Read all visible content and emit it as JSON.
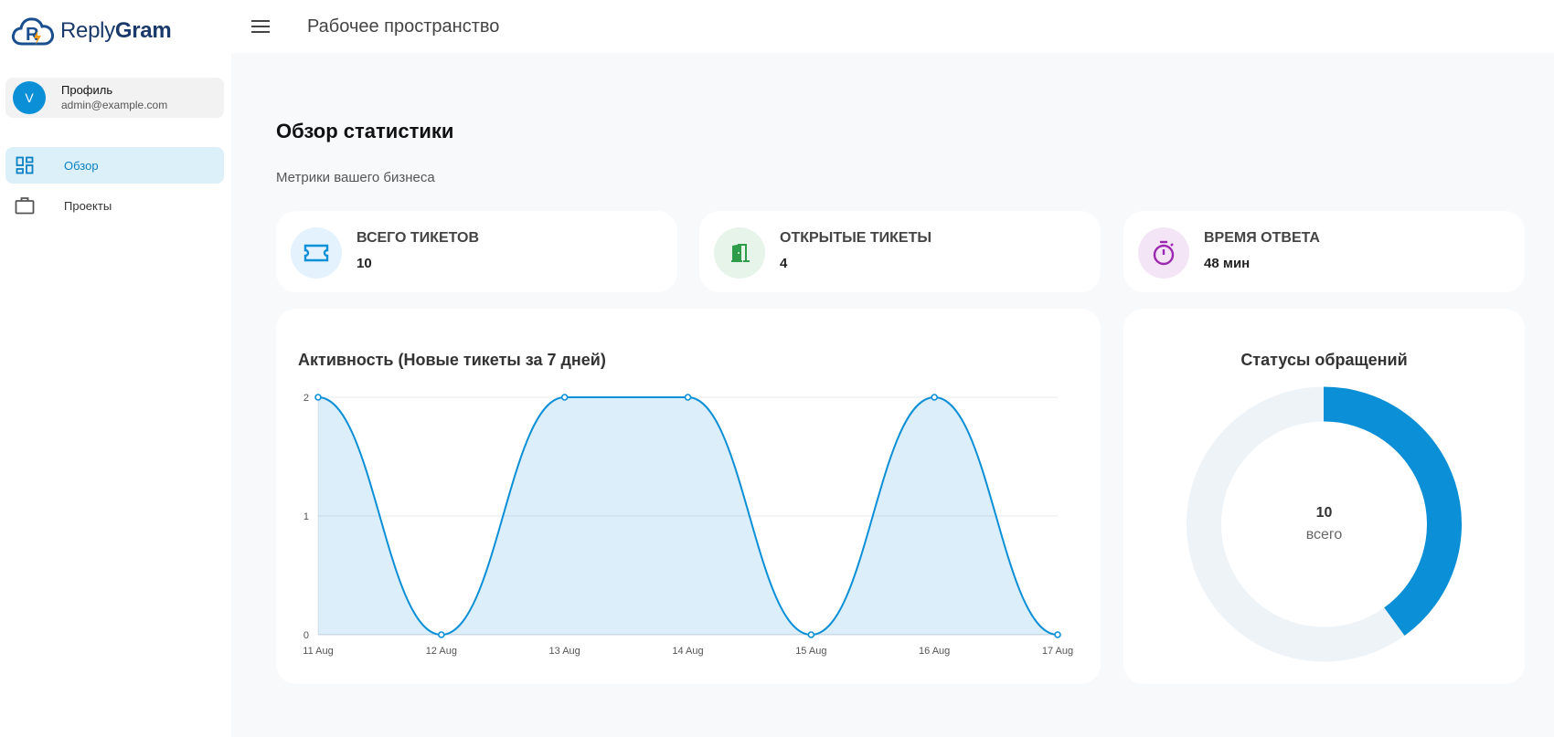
{
  "app": {
    "logo_light": "Reply",
    "logo_bold": "Gram",
    "topbar_title": "Рабочее пространство"
  },
  "profile": {
    "avatar_letter": "V",
    "name": "Профиль",
    "email": "admin@example.com"
  },
  "sidebar": {
    "items": [
      {
        "label": "Обзор",
        "icon": "dashboard-icon",
        "active": true
      },
      {
        "label": "Проекты",
        "icon": "briefcase-icon",
        "active": false
      }
    ]
  },
  "page": {
    "title": "Обзор статистики",
    "subtitle": "Метрики вашего бизнеса"
  },
  "stats": [
    {
      "label": "ВСЕГО ТИКЕТОВ",
      "value": "10",
      "icon": "ticket-icon",
      "color": "#0b8fd6",
      "bg": "#e3f2fd"
    },
    {
      "label": "ОТКРЫТЫЕ ТИКЕТЫ",
      "value": "4",
      "icon": "door-open-icon",
      "color": "#2e9d4a",
      "bg": "#e6f4ea"
    },
    {
      "label": "ВРЕМЯ ОТВЕТА",
      "value": "48 мин",
      "icon": "timer-icon",
      "color": "#9c27b0",
      "bg": "#f3e5f5"
    }
  ],
  "chart_data": [
    {
      "type": "area",
      "title": "Активность (Новые тикеты за 7 дней)",
      "x": [
        "11 Aug",
        "12 Aug",
        "13 Aug",
        "14 Aug",
        "15 Aug",
        "16 Aug",
        "17 Aug"
      ],
      "series": [
        {
          "values": [
            2,
            0,
            2,
            2,
            0,
            2,
            0
          ],
          "color": "#0b8fd6"
        }
      ],
      "ylim": [
        0,
        2
      ],
      "yticks": [
        0,
        1,
        2
      ],
      "grid": true
    },
    {
      "type": "pie",
      "title": "Статусы обращений",
      "total": 10,
      "center_label": "всего",
      "slices": [
        {
          "value": 4,
          "color": "#0b8fd6"
        },
        {
          "value": 6,
          "color": "#eef3f8"
        }
      ]
    }
  ]
}
